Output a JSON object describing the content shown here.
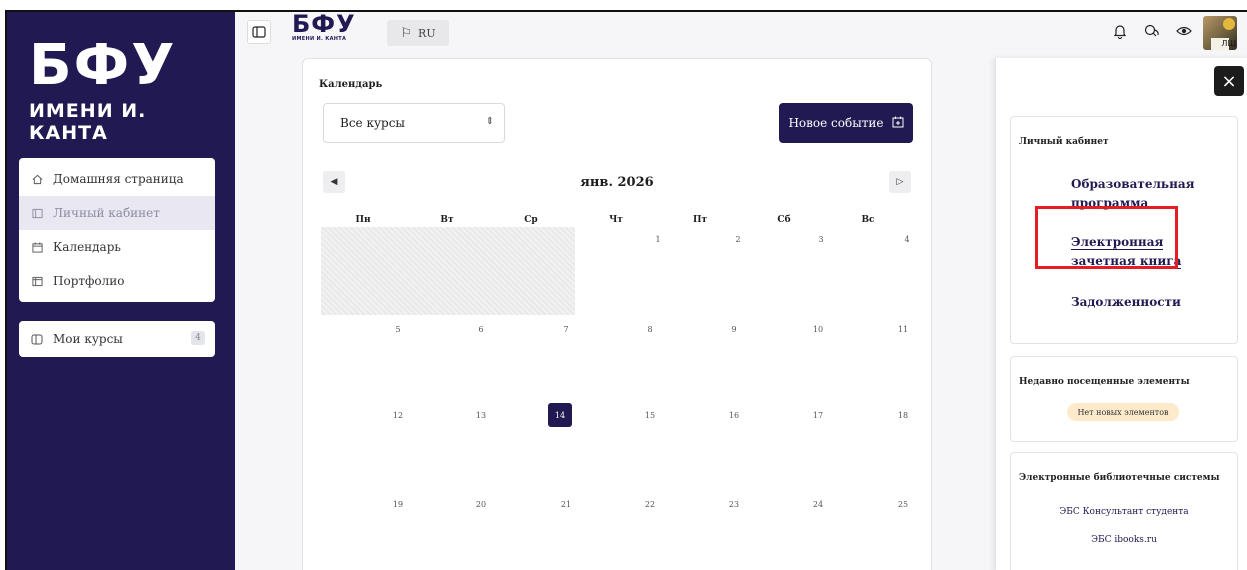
{
  "brand": {
    "logo_big": "БФУ",
    "logo_small": "ИМЕНИ И. КАНТА",
    "top_logo_big": "БФУ",
    "top_logo_small": "ИМЕНИ И. КАНТА"
  },
  "sidebar": {
    "items": [
      {
        "label": "Домашняя страница",
        "icon": "home-icon"
      },
      {
        "label": "Личный кабинет",
        "icon": "cabinet-icon",
        "active": true
      },
      {
        "label": "Календарь",
        "icon": "calendar-icon"
      },
      {
        "label": "Портфолио",
        "icon": "portfolio-icon"
      }
    ],
    "courses_label": "Мои курсы",
    "courses_count": "4"
  },
  "topbar": {
    "lang": "RU",
    "avatar_text": "ЛШ"
  },
  "calendar": {
    "title": "Календарь",
    "course_select": "Все курсы",
    "new_event": "Новое событие",
    "month": "янв. 2026",
    "weekdays": [
      "Пн",
      "Вт",
      "Ср",
      "Чт",
      "Пт",
      "Сб",
      "Вс"
    ],
    "weeks": [
      [
        "",
        "",
        "",
        "1",
        "2",
        "3",
        "4"
      ],
      [
        "5",
        "6",
        "7",
        "8",
        "9",
        "10",
        "11"
      ],
      [
        "12",
        "13",
        "14",
        "15",
        "16",
        "17",
        "18"
      ],
      [
        "19",
        "20",
        "21",
        "22",
        "23",
        "24",
        "25"
      ]
    ],
    "today": "14"
  },
  "drawer": {
    "cabinet_title": "Личный кабинет",
    "links": [
      "Образовательная программа",
      "Электронная зачетная книга",
      "Задолженности"
    ],
    "recent_title": "Недавно посещенные элементы",
    "recent_empty": "Нет новых элементов",
    "library_title": "Электронные библиотечные системы",
    "library_links": [
      "ЭБС Консультант студента",
      "ЭБС ibooks.ru"
    ]
  },
  "colors": {
    "brand": "#211a52",
    "highlight": "#e31e24"
  }
}
